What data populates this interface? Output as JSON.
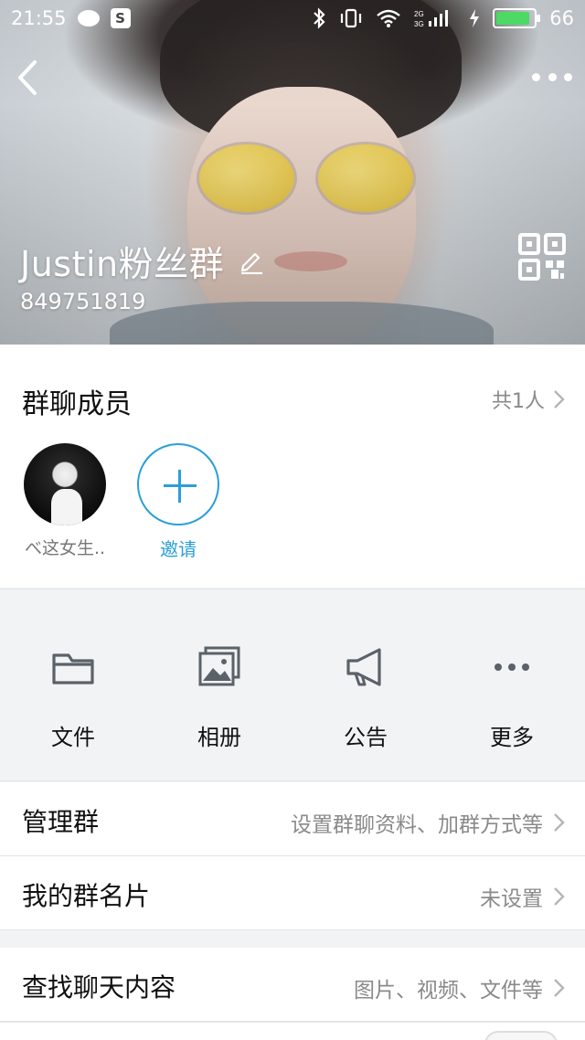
{
  "status_bar": {
    "time": "21:55",
    "battery": "66",
    "icons": [
      "chat-icon",
      "s-app-icon",
      "bluetooth-icon",
      "vibrate-icon",
      "wifi-icon",
      "signal-icon",
      "charging-icon",
      "battery-icon"
    ]
  },
  "header": {
    "group_name": "Justin粉丝群",
    "group_id": "849751819",
    "back_icon": "back-arrow-icon",
    "more_icon": "more-dots-icon",
    "qr_icon": "qr-code-icon",
    "edit_icon": "pencil-icon"
  },
  "members": {
    "title": "群聊成员",
    "count_label": "共1人",
    "list": [
      {
        "name": "べ这女生.."
      }
    ],
    "invite_label": "邀请",
    "accent": "#2a9fd6"
  },
  "actions": [
    {
      "label": "文件",
      "icon": "folder-icon"
    },
    {
      "label": "相册",
      "icon": "album-icon"
    },
    {
      "label": "公告",
      "icon": "megaphone-icon"
    },
    {
      "label": "更多",
      "icon": "more-icon"
    }
  ],
  "rows": [
    {
      "title": "管理群",
      "value": "设置群聊资料、加群方式等"
    },
    {
      "title": "我的群名片",
      "value": "未设置"
    },
    {
      "title": "查找聊天内容",
      "value": "图片、视频、文件等"
    }
  ]
}
